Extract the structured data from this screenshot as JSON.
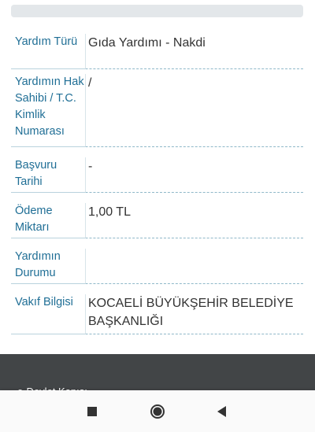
{
  "rows": [
    {
      "label": "Yardım Türü",
      "value": "Gıda Yardımı - Nakdi"
    },
    {
      "label": "Yardımın Hak Sahibi / T.C. Kimlik Numarası",
      "value": "/"
    },
    {
      "label": "Başvuru Tarihi",
      "value": "-"
    },
    {
      "label": "Ödeme Miktarı",
      "value": "1,00 TL"
    },
    {
      "label": "Yardımın Durumu",
      "value": ""
    },
    {
      "label": "Vakıf Bilgisi",
      "value": "KOCAELİ BÜYÜKŞEHİR BELEDİYE BAŞKANLIĞI"
    }
  ],
  "footer": {
    "text": "e-Devlet Kapısı"
  },
  "navbar": {
    "icons": [
      "recent-apps-icon",
      "home-icon",
      "back-icon"
    ]
  },
  "colors": {
    "label": "#1f6e95",
    "value": "#333333",
    "footer_bg": "#424547",
    "separator": "#8fb8c9"
  }
}
